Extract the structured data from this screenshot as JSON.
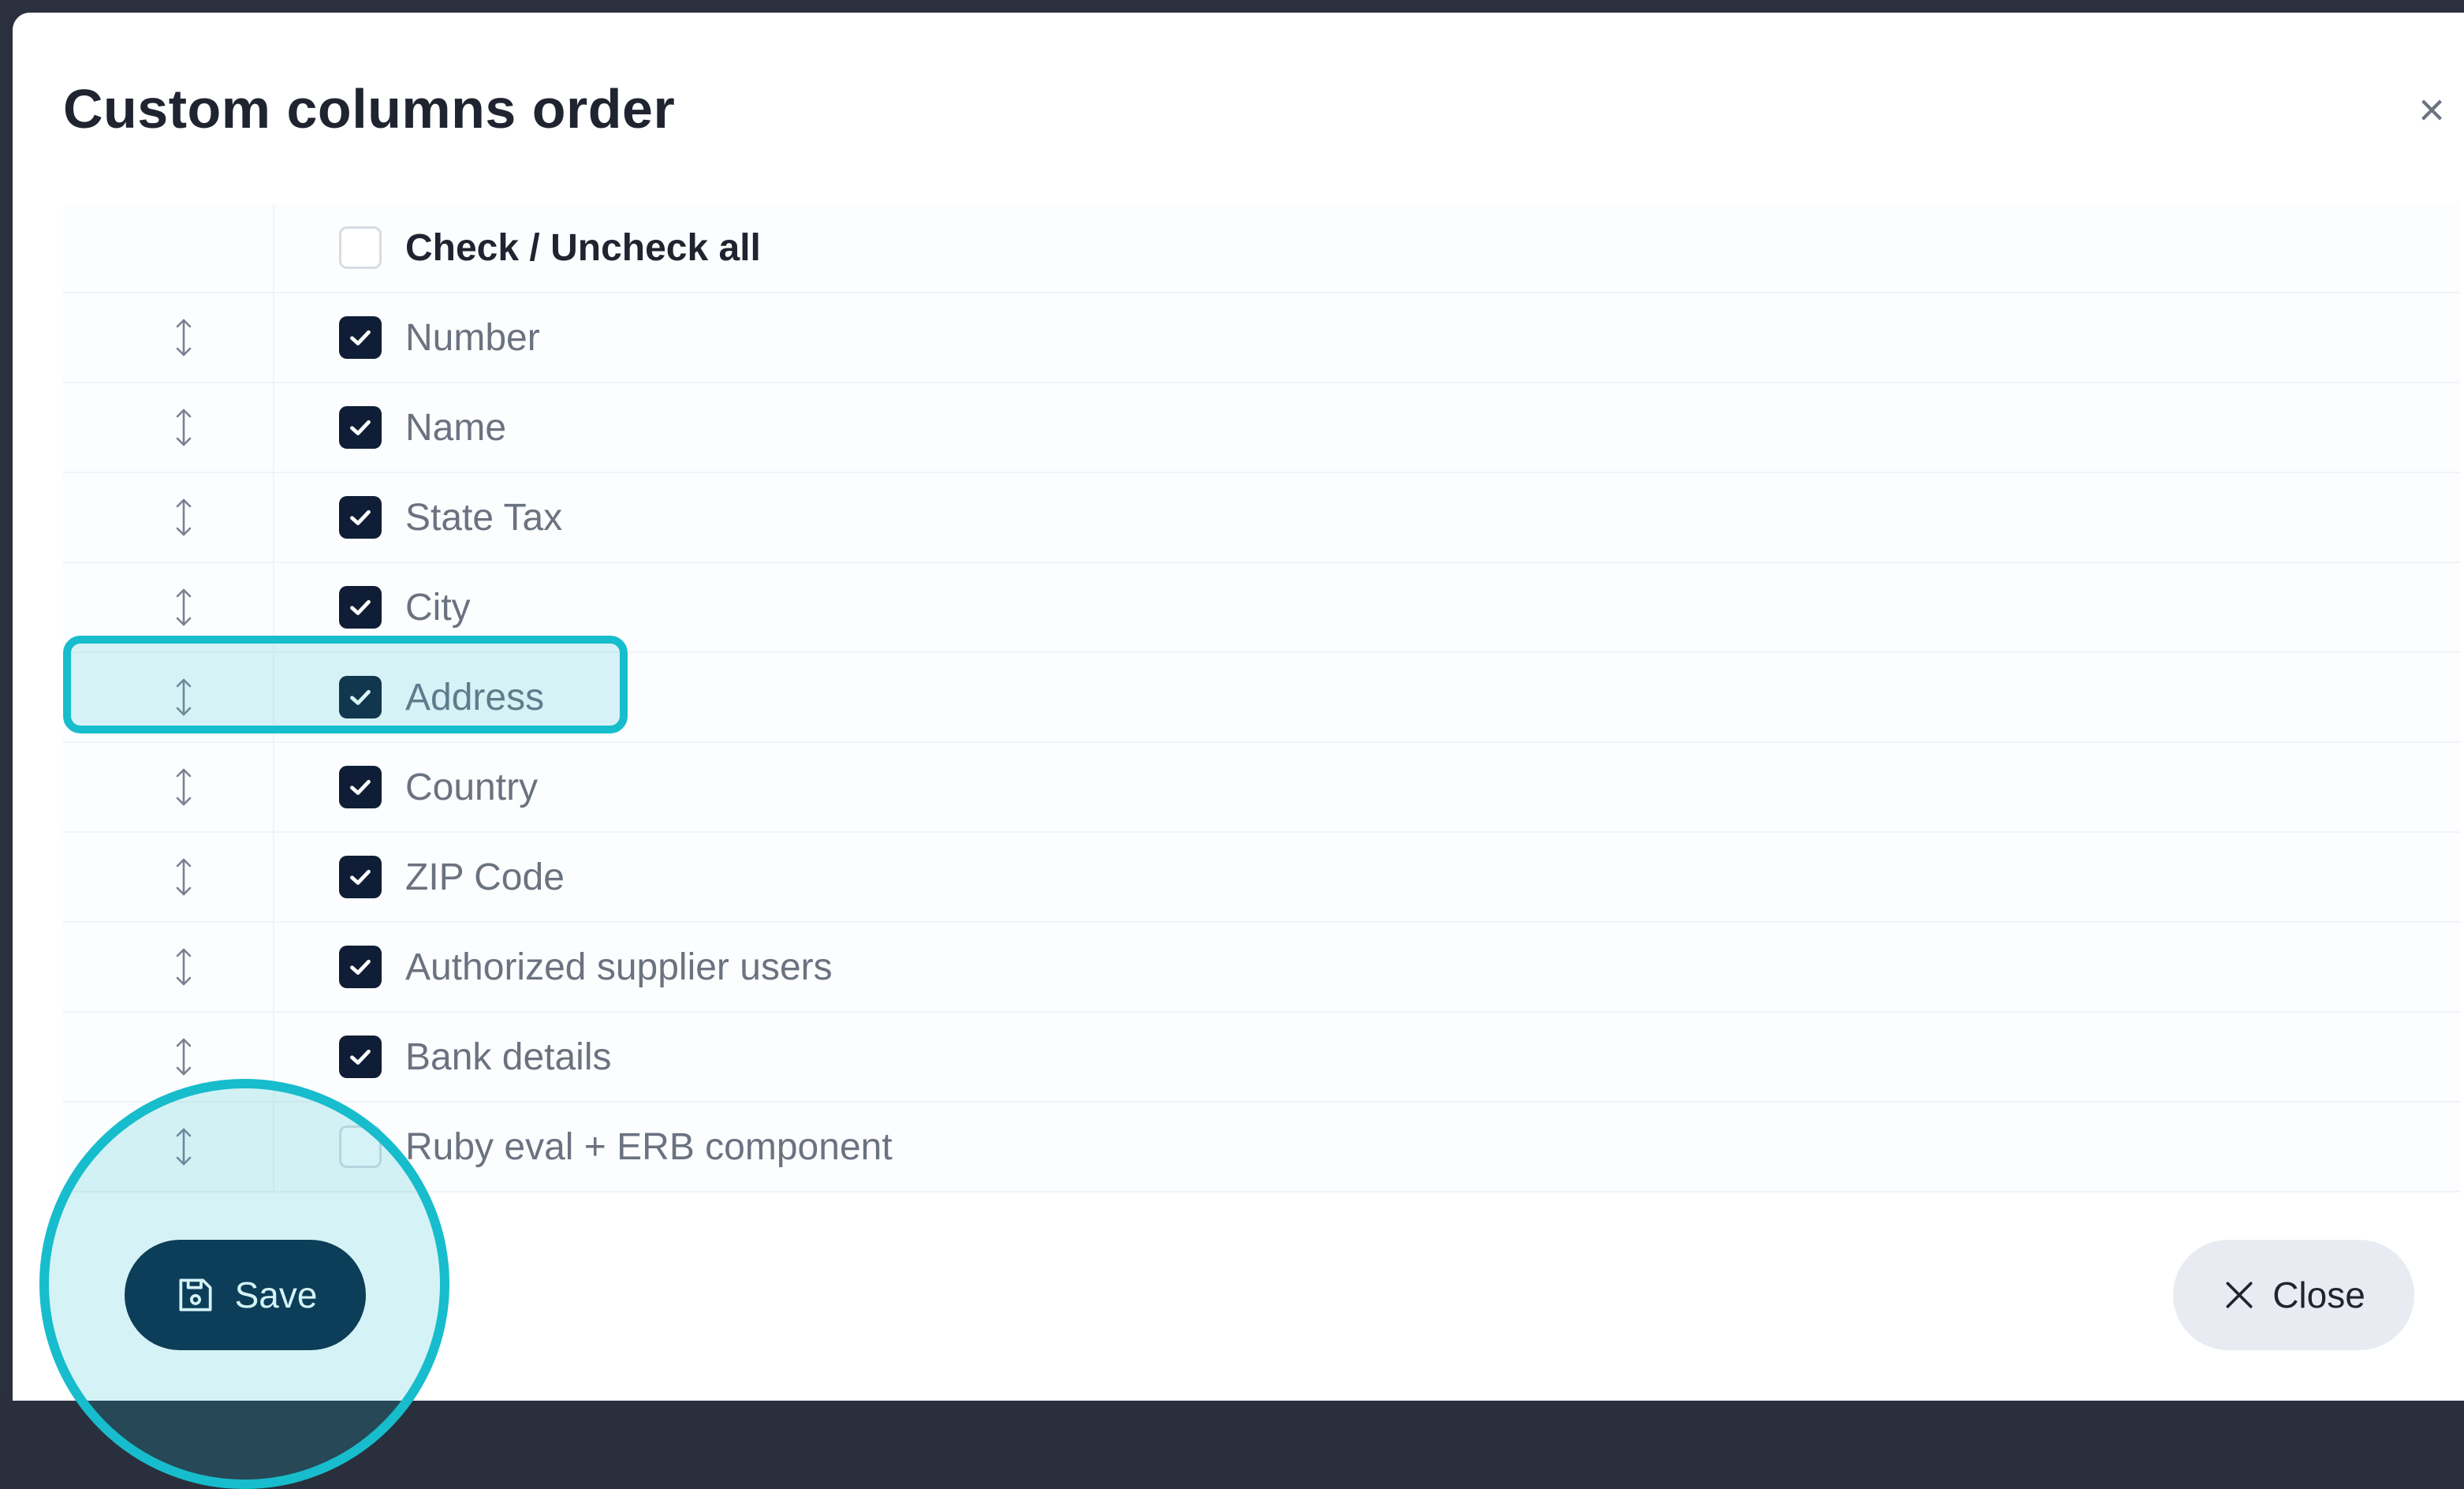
{
  "modal": {
    "title": "Custom columns order",
    "close_x": "×"
  },
  "check_all": {
    "label": "Check / Uncheck all",
    "checked": false
  },
  "columns": [
    {
      "label": "Number",
      "checked": true
    },
    {
      "label": "Name",
      "checked": true
    },
    {
      "label": "State Tax",
      "checked": true
    },
    {
      "label": "City",
      "checked": true
    },
    {
      "label": "Address",
      "checked": true
    },
    {
      "label": "Country",
      "checked": true
    },
    {
      "label": "ZIP Code",
      "checked": true
    },
    {
      "label": "Authorized supplier users",
      "checked": true
    },
    {
      "label": "Bank details",
      "checked": true
    },
    {
      "label": "Ruby eval + ERB component",
      "checked": false
    }
  ],
  "footer": {
    "save_label": "Save",
    "close_label": "Close"
  },
  "colors": {
    "accent_highlight": "#17bdcc",
    "primary_button": "#0c2340",
    "checkbox_checked": "#0f1e36"
  },
  "icons": {
    "drag": "drag-handle-icon",
    "save": "floppy-disk-icon",
    "close": "close-icon"
  }
}
